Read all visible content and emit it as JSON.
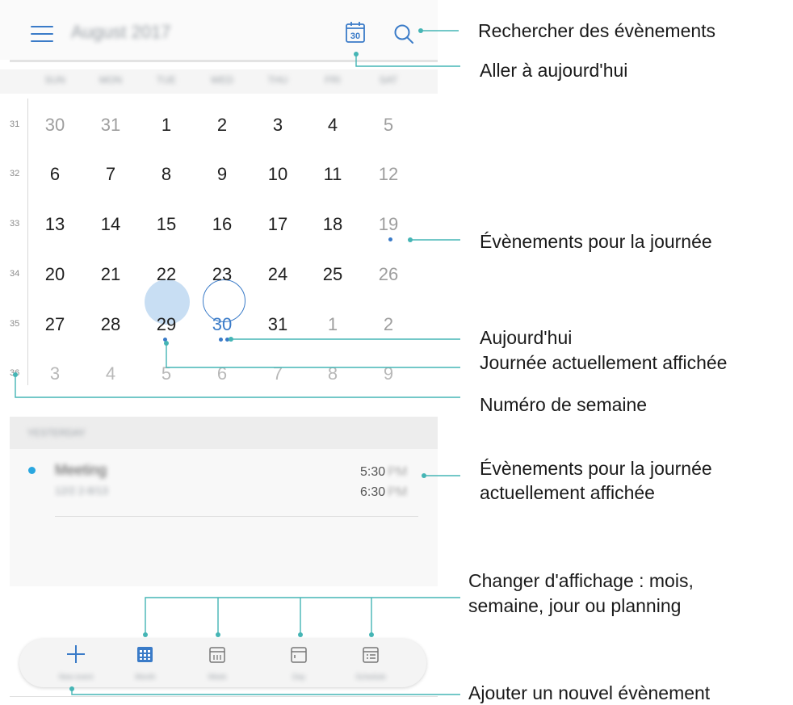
{
  "header": {
    "month_title": "August 2017",
    "today_icon_day": "30"
  },
  "weekdays": [
    "SUN",
    "MON",
    "TUE",
    "WED",
    "THU",
    "FRI",
    "SAT"
  ],
  "weeks": [
    {
      "number": "31",
      "days": [
        "30",
        "31",
        "1",
        "2",
        "3",
        "4",
        "5"
      ]
    },
    {
      "number": "32",
      "days": [
        "6",
        "7",
        "8",
        "9",
        "10",
        "11",
        "12"
      ]
    },
    {
      "number": "33",
      "days": [
        "13",
        "14",
        "15",
        "16",
        "17",
        "18",
        "19"
      ]
    },
    {
      "number": "34",
      "days": [
        "20",
        "21",
        "22",
        "23",
        "24",
        "25",
        "26"
      ]
    },
    {
      "number": "35",
      "days": [
        "27",
        "28",
        "29",
        "30",
        "31",
        "1",
        "2"
      ]
    },
    {
      "number": "36",
      "days": [
        "3",
        "4",
        "5",
        "6",
        "7",
        "8",
        "9"
      ]
    }
  ],
  "agenda": {
    "section_title": "YESTERDAY",
    "events": [
      {
        "title": "Meeting",
        "subtitle": "12/2 2-8/13",
        "start": "5:30",
        "end": "6:30",
        "ampm": "PM"
      }
    ]
  },
  "bottom_nav": [
    {
      "icon": "plus-icon",
      "label": "New event"
    },
    {
      "icon": "month-view-icon",
      "label": "Month"
    },
    {
      "icon": "week-view-icon",
      "label": "Week"
    },
    {
      "icon": "day-view-icon",
      "label": "Day"
    },
    {
      "icon": "schedule-view-icon",
      "label": "Schedule"
    }
  ],
  "callouts": {
    "search": "Rechercher des évènements",
    "go_today": "Aller à aujourd'hui",
    "day_events": "Évènements pour la journée",
    "today": "Aujourd'hui",
    "displayed_day": "Journée actuellement affichée",
    "week_number": "Numéro de semaine",
    "displayed_events_line1": "Évènements pour la journée",
    "displayed_events_line2": "actuellement affichée",
    "change_view_line1": "Changer d'affichage : mois,",
    "change_view_line2": "semaine, jour ou planning",
    "add_event": "Ajouter un nouvel évènement"
  },
  "colors": {
    "accent": "#3a7bc8",
    "selected_fill": "#c8def3",
    "callout_line": "#45b5b5",
    "event_dot": "#2aa7e0"
  }
}
